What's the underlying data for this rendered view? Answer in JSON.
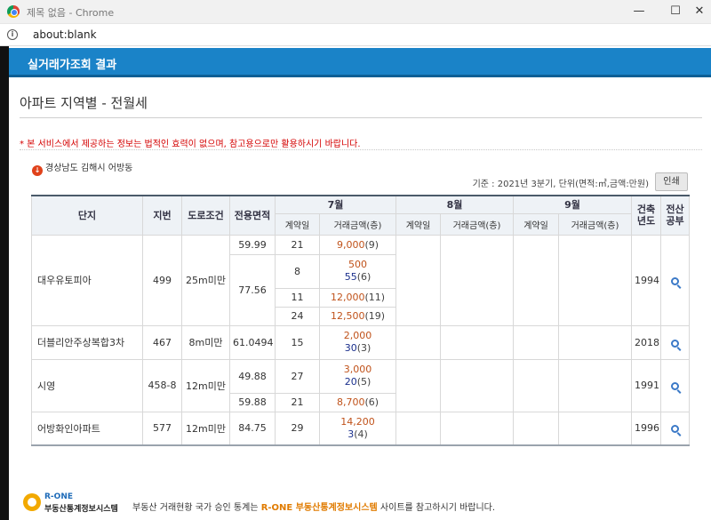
{
  "window": {
    "title": "제목 없음 - Chrome",
    "minimize": "—",
    "maximize": "☐",
    "close": "✕"
  },
  "address": {
    "url": "about:blank"
  },
  "header": {
    "title": "실거래가조회 결과"
  },
  "page": {
    "title": "아파트 지역별 - 전월세"
  },
  "notice": "* 본 서비스에서 제공하는 정보는 법적인 효력이 없으며, 참고용으로만 활용하시기 바랍니다.",
  "region": "경상남도 김해시 어방동",
  "basis": "기준 : 2021년 3분기, 단위(면적:㎡,금액:만원)",
  "print_label": "인쇄",
  "table": {
    "headers": {
      "complex": "단지",
      "lot": "지번",
      "road": "도로조건",
      "area": "전용면적",
      "m7": "7월",
      "m8": "8월",
      "m9": "9월",
      "built": "건축년도",
      "registry": "전산공부",
      "contract_day": "계약일",
      "amount": "거래금액(층)"
    },
    "rows": [
      {
        "name": "대우유토피아",
        "lot": "499",
        "road": "25m미만",
        "built": "1994",
        "area1": "59.99",
        "d1": "21",
        "a1": "9,000",
        "f1": "(9)",
        "area2": "77.56",
        "d2": "8",
        "a2_deposit": "500",
        "a2_rent": "55",
        "f2": "(6)",
        "d3": "11",
        "a3": "12,000",
        "f3": "(11)",
        "d4": "24",
        "a4": "12,500",
        "f4": "(19)"
      },
      {
        "name": "더블리안주상복합3차",
        "lot": "467",
        "road": "8m미만",
        "built": "2018",
        "area1": "61.0494",
        "d1": "15",
        "a1_deposit": "2,000",
        "a1_rent": "30",
        "f1": "(3)"
      },
      {
        "name": "시영",
        "lot": "458-8",
        "road": "12m미만",
        "built": "1991",
        "area1": "49.88",
        "d1": "27",
        "a1_deposit": "3,000",
        "a1_rent": "20",
        "f1": "(5)",
        "area2": "59.88",
        "d2": "21",
        "a2": "8,700",
        "f2": "(6)"
      },
      {
        "name": "어방화인아파트",
        "lot": "577",
        "road": "12m미만",
        "built": "1996",
        "area1": "84.75",
        "d1": "29",
        "a1_deposit": "14,200",
        "a1_rent": "3",
        "f1": "(4)"
      }
    ]
  },
  "footer": {
    "brand": "R-ONE",
    "brand_sub": "부동산통계정보시스템",
    "text_before": "부동산 거래현황 국가 승인 통계는 ",
    "text_link": "R-ONE 부동산통계정보시스템",
    "text_after": " 사이트를 참고하시기 바랍니다."
  },
  "colors": {
    "header": "#1a83c8",
    "notice": "#d40000",
    "amount": "#c0521a",
    "rent": "#1a2f8c"
  }
}
